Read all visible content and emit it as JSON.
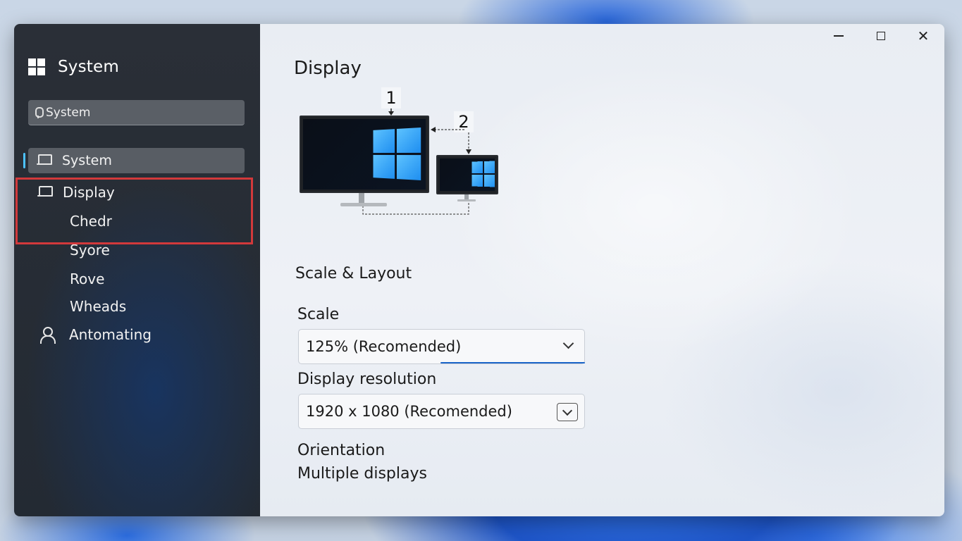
{
  "app": {
    "title": "System"
  },
  "search": {
    "value": "System"
  },
  "sidebar": {
    "items": [
      {
        "label": "System",
        "icon": "laptop-icon",
        "selected": true
      },
      {
        "label": "Display",
        "icon": "laptop-icon"
      },
      {
        "label": "Chedr"
      },
      {
        "label": "Syore"
      },
      {
        "label": "Rove"
      },
      {
        "label": "Wheads"
      },
      {
        "label": "Antomating",
        "icon": "person-icon"
      }
    ]
  },
  "window_controls": {
    "minimize": "minimize",
    "maximize": "maximize",
    "close": "close"
  },
  "main": {
    "title": "Display",
    "monitors": {
      "primary_label": "1",
      "secondary_label": "2"
    },
    "section_title": "Scale & Layout",
    "scale": {
      "label": "Scale",
      "value": "125% (Recomended)"
    },
    "resolution": {
      "label": "Display resolution",
      "value": "1920 x 1080 (Recomended)"
    },
    "orientation_label": "Orientation",
    "multiple_displays_label": "Multiple displays"
  },
  "colors": {
    "accent": "#1a64c8",
    "highlight": "#d2393b",
    "selection_bar": "#4cc2ff"
  }
}
